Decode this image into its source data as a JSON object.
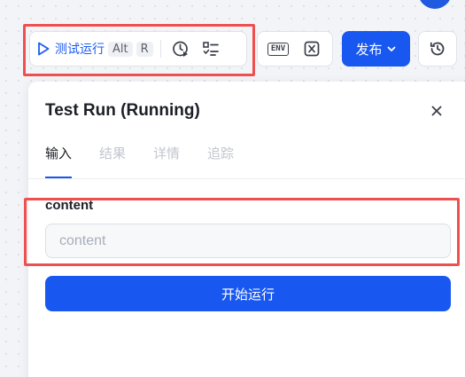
{
  "toolbar": {
    "run_label": "测试运行",
    "shortcut_alt": "Alt",
    "shortcut_key": "R",
    "env_label": "ENV",
    "publish_label": "发布"
  },
  "panel": {
    "title": "Test Run (Running)",
    "tabs": [
      {
        "label": "输入",
        "active": true
      },
      {
        "label": "结果",
        "active": false
      },
      {
        "label": "详情",
        "active": false
      },
      {
        "label": "追踪",
        "active": false
      }
    ],
    "field_label": "content",
    "field_placeholder": "content",
    "field_value": "",
    "start_label": "开始运行"
  },
  "colors": {
    "primary": "#1858f0",
    "highlight": "#ee5050"
  }
}
